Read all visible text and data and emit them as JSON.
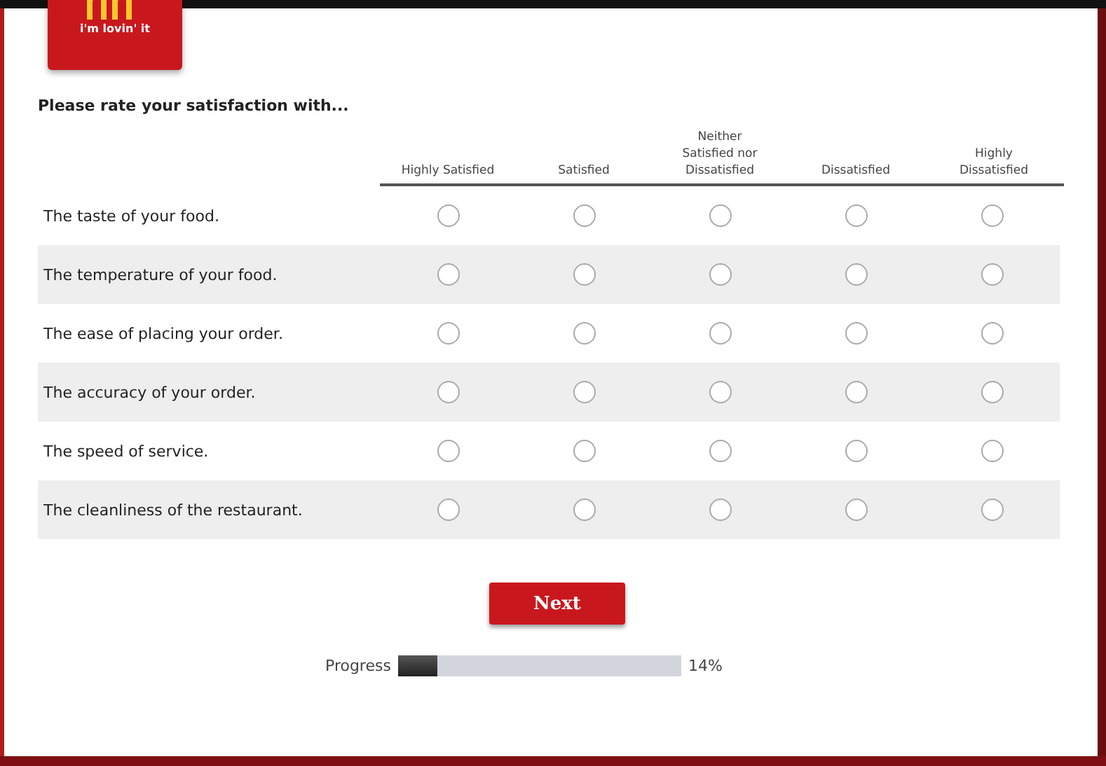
{
  "logo": {
    "tagline": "i'm lovin' it"
  },
  "question": "Please rate your satisfaction with...",
  "columns": [
    "Highly Satisfied",
    "Satisfied",
    "Neither Satisfied nor Dissatisfied",
    "Dissatisfied",
    "Highly Dissatisfied"
  ],
  "rows": [
    {
      "label": "The taste of your food.",
      "choices": [
        {
          "selected": false
        },
        {
          "selected": false
        },
        {
          "selected": false
        },
        {
          "selected": false
        },
        {
          "selected": false
        }
      ]
    },
    {
      "label": "The temperature of your food.",
      "choices": [
        {
          "selected": false
        },
        {
          "selected": false
        },
        {
          "selected": false
        },
        {
          "selected": false
        },
        {
          "selected": false
        }
      ]
    },
    {
      "label": "The ease of placing your order.",
      "choices": [
        {
          "selected": false
        },
        {
          "selected": false
        },
        {
          "selected": false
        },
        {
          "selected": false
        },
        {
          "selected": false
        }
      ]
    },
    {
      "label": "The accuracy of your order.",
      "choices": [
        {
          "selected": false
        },
        {
          "selected": false
        },
        {
          "selected": false
        },
        {
          "selected": false
        },
        {
          "selected": false
        }
      ]
    },
    {
      "label": "The speed of service.",
      "choices": [
        {
          "selected": false
        },
        {
          "selected": false
        },
        {
          "selected": false
        },
        {
          "selected": false
        },
        {
          "selected": false
        }
      ]
    },
    {
      "label": "The cleanliness of the restaurant.",
      "choices": [
        {
          "selected": false
        },
        {
          "selected": false
        },
        {
          "selected": false
        },
        {
          "selected": false
        },
        {
          "selected": false
        }
      ]
    }
  ],
  "next_button": "Next",
  "progress": {
    "label": "Progress",
    "level": 0.14,
    "reading": "14%"
  }
}
